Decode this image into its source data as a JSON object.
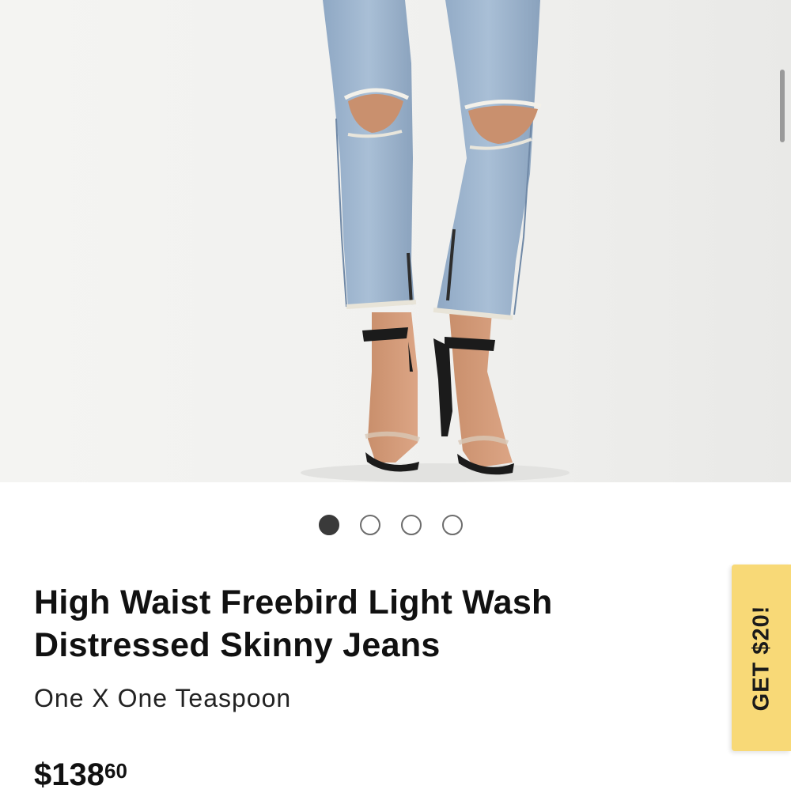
{
  "product": {
    "title": "High Waist Freebird Light Wash Distressed Skinny Jeans",
    "brand": "One X One Teaspoon",
    "price_dollars": "$138",
    "price_cents": "60"
  },
  "carousel": {
    "total_images": 4,
    "active_index": 0
  },
  "promo": {
    "label": "GET $20!"
  },
  "colors": {
    "promo_background": "#f8d977",
    "active_dot": "#3a3a3a"
  }
}
